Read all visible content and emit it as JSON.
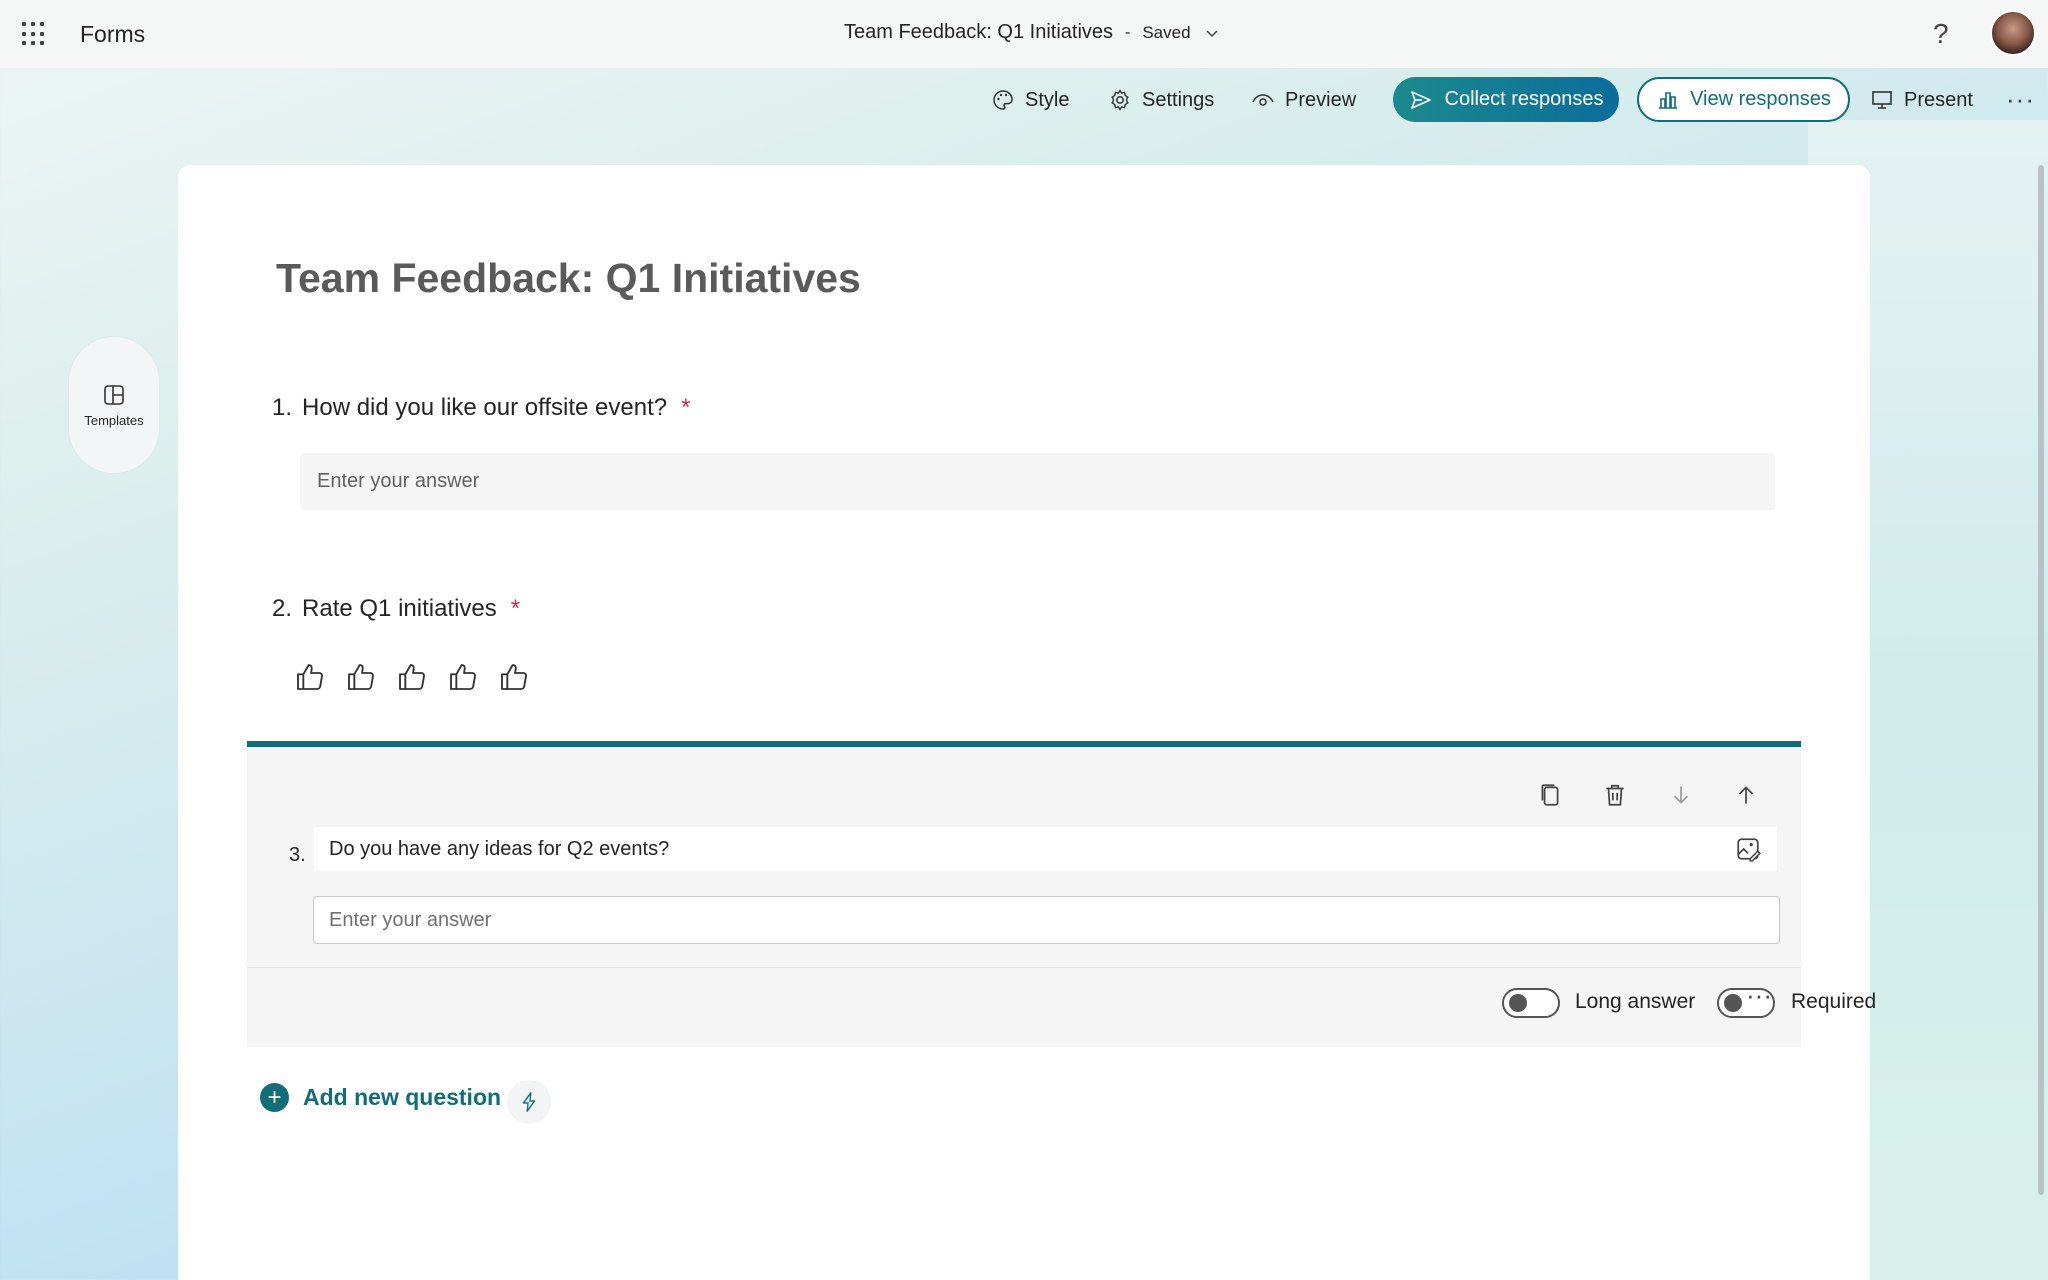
{
  "app": {
    "name": "Forms"
  },
  "document": {
    "title": "Team Feedback: Q1 Initiatives",
    "separator": "-",
    "status": "Saved"
  },
  "toolbar": {
    "style_label": "Style",
    "settings_label": "Settings",
    "preview_label": "Preview",
    "collect_label": "Collect responses",
    "view_label": "View responses",
    "present_label": "Present",
    "more_label": "···"
  },
  "help_label": "?",
  "sidebar": {
    "templates_label": "Templates"
  },
  "form": {
    "title": "Team Feedback: Q1 Initiatives",
    "questions": [
      {
        "number": "1.",
        "text": "How did you like our offsite event?",
        "required_mark": "*",
        "placeholder": "Enter your answer"
      },
      {
        "number": "2.",
        "text": "Rate Q1 initiatives",
        "required_mark": "*",
        "rating_max": 5
      },
      {
        "number": "3.",
        "text": "Do you have any ideas for Q2 events?",
        "placeholder": "Enter your answer",
        "long_answer_label": "Long answer",
        "long_answer_on": false,
        "required_label": "Required",
        "required_on": false,
        "more_label": "···"
      }
    ],
    "add_question_label": "Add new question",
    "add_plus": "+"
  },
  "colors": {
    "accent": "#0f6e78",
    "required": "#c4314b"
  },
  "icons": [
    "app-launcher-icon",
    "chevron-down-icon",
    "help-icon",
    "palette-icon",
    "gear-icon",
    "eye-icon",
    "send-icon",
    "bar-chart-icon",
    "monitor-icon",
    "templates-icon",
    "thumb-up-icon",
    "copy-icon",
    "trash-icon",
    "arrow-down-icon",
    "arrow-up-icon",
    "image-edit-icon",
    "plus-icon",
    "bolt-icon"
  ]
}
